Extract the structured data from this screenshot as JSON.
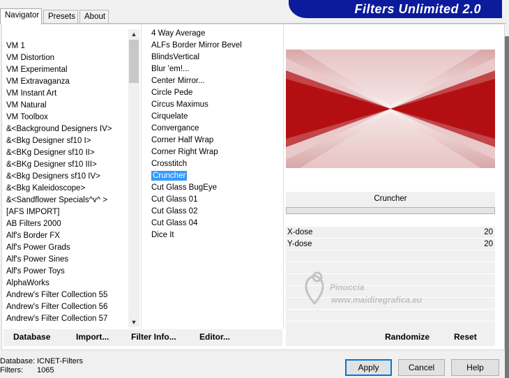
{
  "tabs": [
    {
      "label": "Navigator",
      "active": true
    },
    {
      "label": "Presets",
      "active": false
    },
    {
      "label": "About",
      "active": false
    }
  ],
  "banner": {
    "title": "Filters Unlimited 2.0",
    "color": "#0b1b9c"
  },
  "categories": [
    "VM 1",
    "VM Distortion",
    "VM Experimental",
    "VM Extravaganza",
    "VM Instant Art",
    "VM Natural",
    "VM Toolbox",
    "&<Background Designers IV>",
    "&<Bkg Designer sf10 I>",
    "&<BKg Designer sf10 II>",
    "&<BKg Designer sf10 III>",
    "&<Bkg Designers sf10 IV>",
    "&<Bkg Kaleidoscope>",
    "&<Sandflower Specials^v^ >",
    "[AFS IMPORT]",
    "AB Filters 2000",
    "Alf's Border FX",
    "Alf's Power Grads",
    "Alf's Power Sines",
    "Alf's Power Toys",
    "AlphaWorks",
    "Andrew's Filter Collection 55",
    "Andrew's Filter Collection 56",
    "Andrew's Filter Collection 57"
  ],
  "filters": [
    "4 Way Average",
    "ALFs Border Mirror Bevel",
    "BlindsVertical",
    "Blur 'em!...",
    "Center Mirror...",
    "Circle Pede",
    "Circus Maximus",
    "Cirquelate",
    "Convergance",
    "Corner Half Wrap",
    "Corner Right Wrap",
    "Crosstitch",
    "Cruncher",
    "Cut Glass  BugEye",
    "Cut Glass 01",
    "Cut Glass 02",
    "Cut Glass 04",
    "Dice It"
  ],
  "selected_filter": "Cruncher",
  "filter_name": "Cruncher",
  "params": [
    {
      "label": "X-dose",
      "value": "20"
    },
    {
      "label": "Y-dose",
      "value": "20"
    }
  ],
  "watermark": {
    "line1": "Pinuccia",
    "line2": "www.maidiregrafica.eu"
  },
  "bottom_bar": {
    "database": "Database",
    "import": "Import...",
    "filter_info": "Filter Info...",
    "editor": "Editor...",
    "randomize": "Randomize",
    "reset": "Reset"
  },
  "status": {
    "database_label": "Database:",
    "database_value": "ICNET-Filters",
    "filters_label": "Filters:",
    "filters_value": "1065"
  },
  "buttons": {
    "apply": "Apply",
    "cancel": "Cancel",
    "help": "Help"
  },
  "colors": {
    "accent": "#3399ff",
    "preview_red": "#b30f12",
    "preview_light": "#f6e8e8"
  },
  "icons": {
    "scroll_up": "▲",
    "scroll_down": "▼"
  }
}
